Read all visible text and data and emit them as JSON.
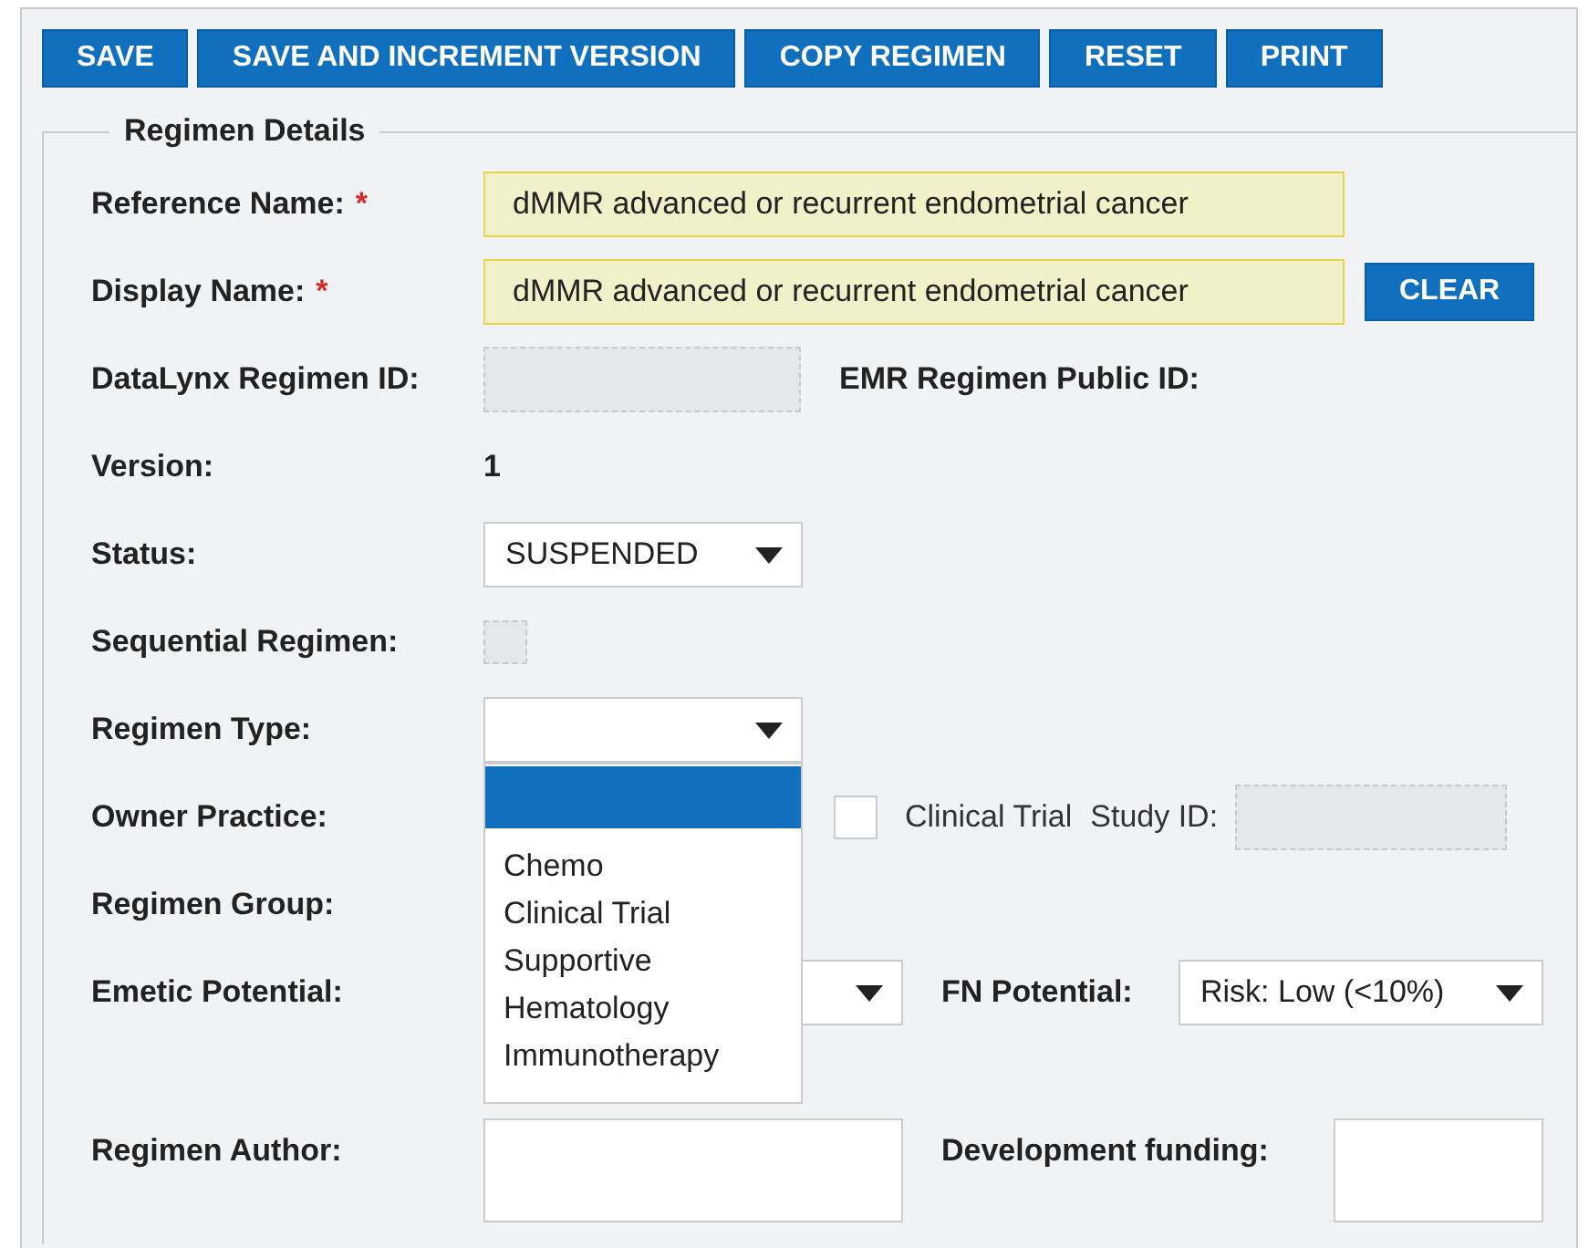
{
  "toolbar": {
    "buttons": [
      "SAVE",
      "SAVE AND INCREMENT VERSION",
      "COPY REGIMEN",
      "RESET",
      "PRINT"
    ]
  },
  "section": {
    "legend": "Regimen Details",
    "rows": [
      {
        "kind": "text",
        "label": "Reference Name:",
        "required_mark": "*",
        "value": "dMMR advanced or recurrent endometrial cancer"
      },
      {
        "kind": "text",
        "label": "Display Name:",
        "required_mark": "*",
        "value": "dMMR advanced or recurrent endometrial cancer",
        "button": "CLEAR"
      },
      {
        "kind": "id",
        "label": "DataLynx Regimen ID:",
        "disabled": true,
        "label2": "EMR Regimen Public ID:"
      },
      {
        "kind": "static",
        "label": "Version:",
        "value": "1"
      },
      {
        "kind": "select",
        "label": "Status:",
        "value": "SUSPENDED"
      },
      {
        "kind": "checkbox",
        "label": "Sequential Regimen:",
        "checked": false,
        "disabled": true
      },
      {
        "kind": "dropdown",
        "label": "Regimen Type:",
        "open": true,
        "blank_option_selected": true,
        "options": [
          {
            "label": "Chemo",
            "selected": false
          },
          {
            "label": "Clinical Trial",
            "selected": false
          },
          {
            "label": "Supportive",
            "selected": false
          },
          {
            "label": "Hematology",
            "selected": false
          },
          {
            "label": "Immunotherapy",
            "selected": false
          }
        ]
      },
      {
        "kind": "owner",
        "label": "Owner Practice:",
        "trial_checked": false,
        "trial_label": "Clinical Trial",
        "study_label": "Study ID:",
        "study_disabled": true
      },
      {
        "kind": "plain",
        "label": "Regimen Group:"
      },
      {
        "kind": "selectpair",
        "label": "Emetic Potential:",
        "label2": "FN Potential:",
        "value2": "Risk: Low (<10%)"
      },
      {
        "kind": "areapair",
        "label": "Regimen Author:",
        "label2": "Development funding:"
      }
    ]
  }
}
